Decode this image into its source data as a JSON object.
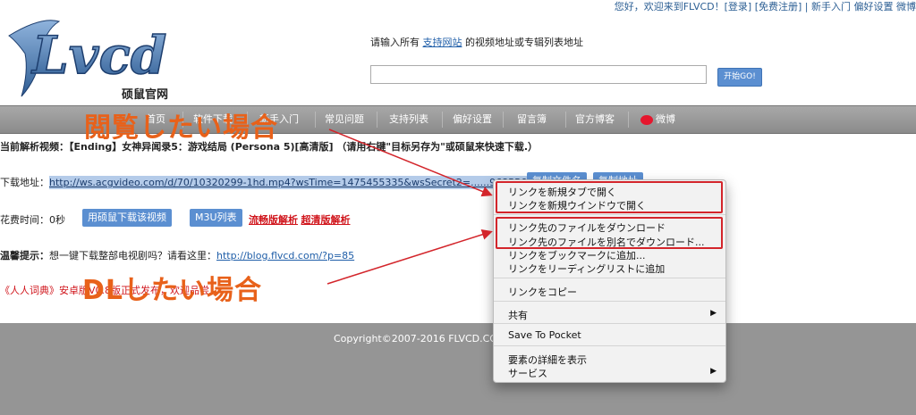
{
  "toplinks": "您好，欢迎来到FLVCD！[登录] [免费注册] | 新手入门  偏好设置  微博",
  "logo": {
    "text": "FLVcd",
    "sub": "硕鼠官网"
  },
  "prompt": {
    "before": "请输入所有 ",
    "link": "支持网站",
    "after": " 的视频地址或专辑列表地址"
  },
  "search": {
    "value": "",
    "button": "开始GO!"
  },
  "nav": [
    "首页",
    "软件下载",
    "新手入门",
    "常见问题",
    "支持列表",
    "偏好设置",
    "留言簿",
    "官方博客",
    "微博"
  ],
  "current": "当前解析视频：【Ending】女神异闻录5：游戏结局 (Persona 5)[高清版] （请用右键\"目标另存为\"或硕鼠来快速下载.）",
  "download": {
    "label": "下载地址：",
    "url": "http://ws.acgvideo.com/d/70/10320299-1hd.mp4?wsTime=1475455335&wsSecret2=......96855&rate=300",
    "copy_name": "复制文件名",
    "copy_url": "复制地址"
  },
  "time": {
    "label": "花费时间：0秒",
    "btn1": "用硕鼠下载该视频",
    "btn2": "M3U列表",
    "link1": "流畅版解析",
    "link2": "超清版解析"
  },
  "tip": {
    "label": "温馨提示：",
    "text": "想一键下载整部电视剧吗？请看这里：",
    "link": "http://blog.flvcd.com/?p=85"
  },
  "promo": "《人人词典》安卓版V0.8版正式发布，欢迎品尝！",
  "footer": "Copyright©2007-2016 FLVCD.COM",
  "context_menu": {
    "items": [
      "リンクを新規タブで開く",
      "リンクを新規ウインドウで開く",
      "リンク先のファイルをダウンロード",
      "リンク先のファイルを別名でダウンロード...",
      "リンクをブックマークに追加...",
      "リンクをリーディングリストに追加",
      "リンクをコピー",
      "共有",
      "Save To Pocket",
      "要素の詳細を表示",
      "サービス"
    ]
  },
  "annotations": {
    "view": "閲覧したい場合",
    "dl": "DLしたい場合"
  },
  "colors": {
    "annot": "#e8611a",
    "highlight": "#d3252b",
    "nav_bg": "#9a9a9a",
    "button": "#5b8fd1"
  }
}
